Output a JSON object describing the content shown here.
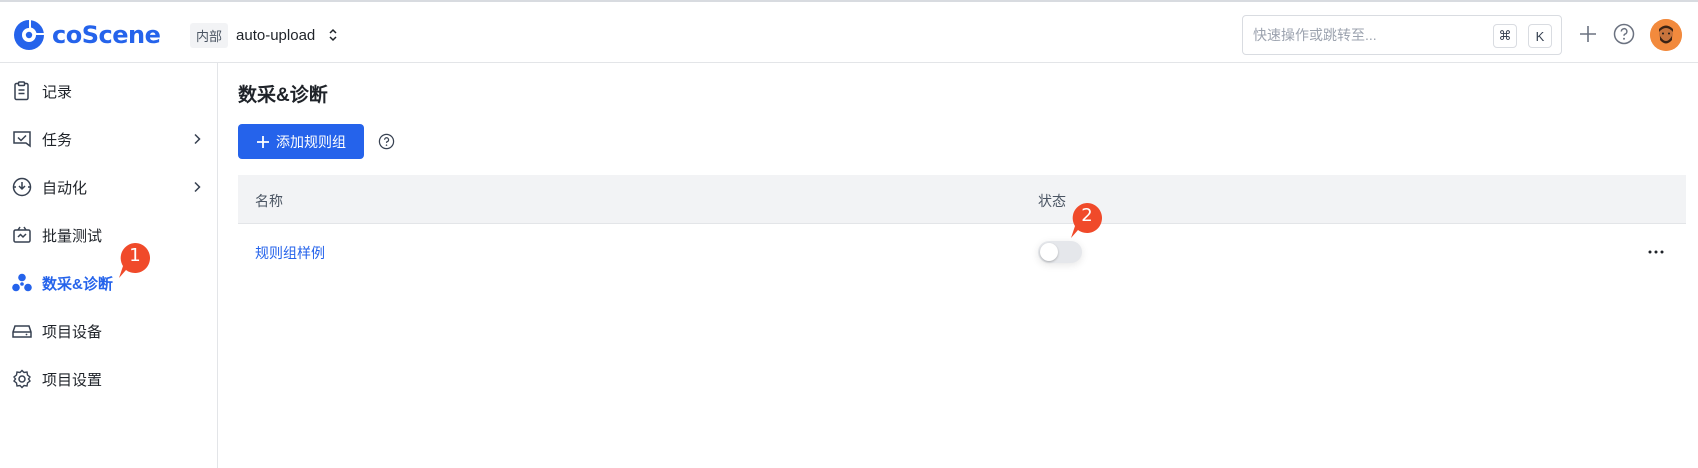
{
  "brand": {
    "name": "coScene",
    "accent": "#2563eb"
  },
  "header": {
    "project_badge": "内部",
    "project_name": "auto-upload",
    "search_placeholder": "快速操作或跳转至...",
    "shortcut_cmd": "⌘",
    "shortcut_key": "K"
  },
  "sidebar": {
    "items": [
      {
        "label": "记录",
        "icon": "clipboard-icon"
      },
      {
        "label": "任务",
        "icon": "task-icon",
        "has_children": true
      },
      {
        "label": "自动化",
        "icon": "automation-icon",
        "has_children": true
      },
      {
        "label": "批量测试",
        "icon": "batch-test-icon"
      },
      {
        "label": "数采&诊断",
        "icon": "diagnosis-icon",
        "active": true
      },
      {
        "label": "项目设备",
        "icon": "device-icon"
      },
      {
        "label": "项目设置",
        "icon": "gear-icon"
      }
    ]
  },
  "main": {
    "title": "数采&诊断",
    "add_button_label": "添加规则组",
    "table": {
      "columns": [
        "名称",
        "状态"
      ],
      "rows": [
        {
          "name": "规则组样例",
          "enabled": false
        }
      ]
    }
  },
  "markers": [
    {
      "label": "1",
      "color": "#f04a2a"
    },
    {
      "label": "2",
      "color": "#f04a2a"
    }
  ]
}
